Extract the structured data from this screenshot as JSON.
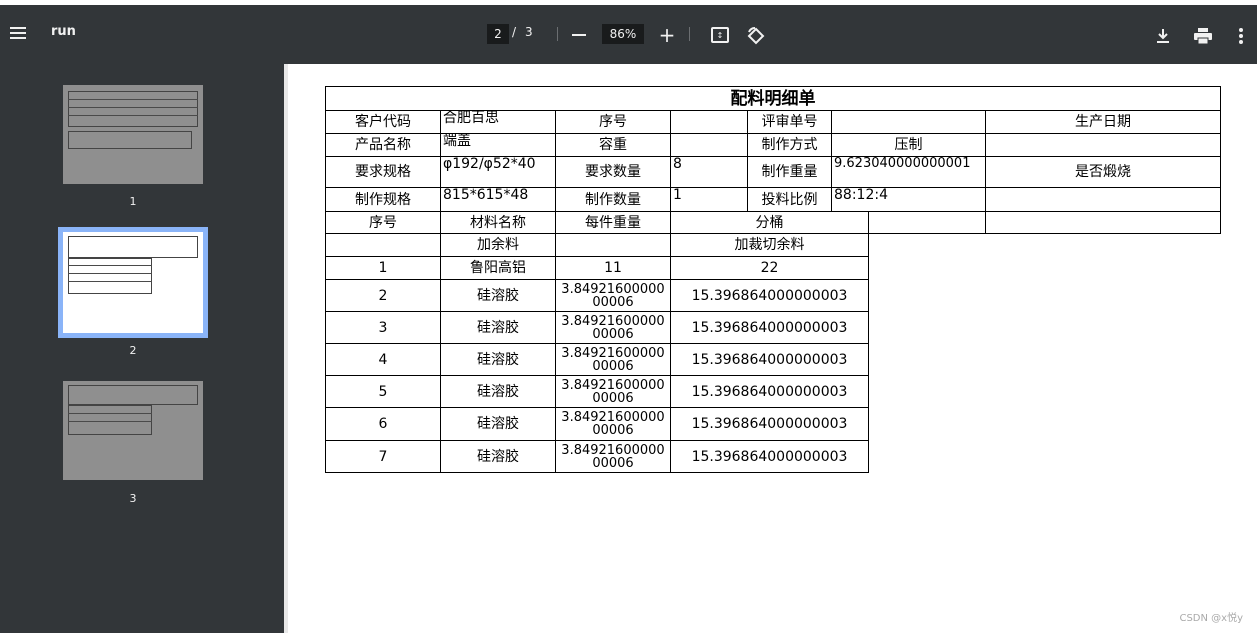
{
  "toolbar": {
    "title": "run",
    "current_page": "2",
    "page_separator": "/",
    "total_pages": "3",
    "zoom": "86%",
    "icons": [
      "menu-icon",
      "zoom-out-icon",
      "zoom-in-icon",
      "fit-page-icon",
      "rotate-icon",
      "download-icon",
      "print-icon",
      "more-icon"
    ]
  },
  "sidebar": {
    "thumbnails": [
      {
        "label": "1"
      },
      {
        "label": "2"
      },
      {
        "label": "3"
      }
    ],
    "accent_color": "#8ab4f8"
  },
  "document": {
    "title": "配料明细单",
    "header": {
      "customer_code_label": "客户代码",
      "customer_code_value": "合肥百思",
      "seq_label": "序号",
      "seq_value": "",
      "review_no_label": "评审单号",
      "review_no_value": "",
      "production_date_label": "生产日期",
      "production_date_value": "",
      "product_name_label": "产品名称",
      "product_name_value": "端盖",
      "capacity_label": "容重",
      "capacity_value": "",
      "method_label": "制作方式",
      "method_value": "压制",
      "req_spec_label": "要求规格",
      "req_spec_value": "φ192/φ52*40",
      "req_qty_label": "要求数量",
      "req_qty_value": "8",
      "make_weight_label": "制作重量",
      "make_weight_value": "9.623040000000001",
      "calcine_label": "是否煅烧",
      "make_spec_label": "制作规格",
      "make_spec_value": "815*615*48",
      "make_qty_label": "制作数量",
      "make_qty_value": "1",
      "ratio_label": "投料比例",
      "ratio_value": "88:12:4"
    },
    "columns": {
      "seq": "序号",
      "material": "材料名称",
      "unit_weight": "每件重量",
      "bucket": "分桶"
    },
    "subheader": {
      "extra_material": "加余料",
      "cut_extra": "加裁切余料"
    },
    "rows": [
      {
        "seq": "1",
        "material": "鲁阳高铝",
        "unit_weight": "11",
        "bucket": "22"
      },
      {
        "seq": "2",
        "material": "硅溶胶",
        "unit_weight": "3.8492160000000006",
        "bucket": "15.396864000000003"
      },
      {
        "seq": "3",
        "material": "硅溶胶",
        "unit_weight": "3.8492160000000006",
        "bucket": "15.396864000000003"
      },
      {
        "seq": "4",
        "material": "硅溶胶",
        "unit_weight": "3.8492160000000006",
        "bucket": "15.396864000000003"
      },
      {
        "seq": "5",
        "material": "硅溶胶",
        "unit_weight": "3.8492160000000006",
        "bucket": "15.396864000000003"
      },
      {
        "seq": "6",
        "material": "硅溶胶",
        "unit_weight": "3.8492160000000006",
        "bucket": "15.396864000000003"
      },
      {
        "seq": "7",
        "material": "硅溶胶",
        "unit_weight": "3.8492160000000006",
        "bucket": "15.396864000000003"
      }
    ]
  },
  "watermark": "CSDN @x悦y"
}
